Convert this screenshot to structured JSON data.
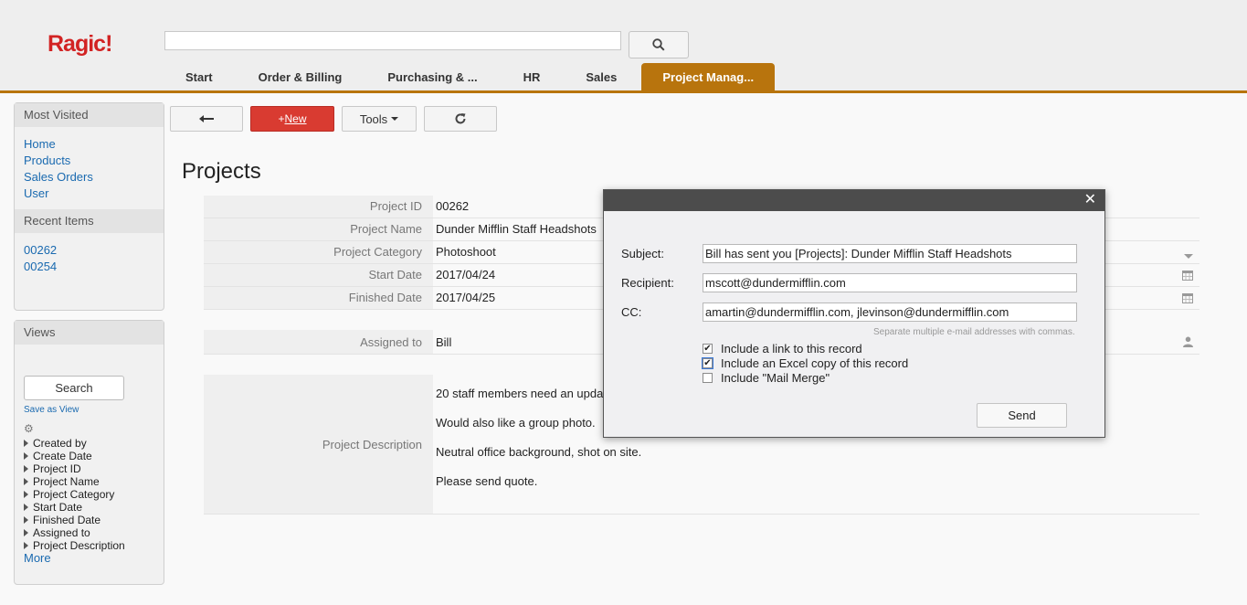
{
  "header": {
    "logo": "Ragic!",
    "search_value": "",
    "tabs": [
      {
        "label": "Start"
      },
      {
        "label": "Order & Billing"
      },
      {
        "label": "Purchasing & ..."
      },
      {
        "label": "HR"
      },
      {
        "label": "Sales"
      },
      {
        "label": "Project Manag..."
      }
    ],
    "accent_color": "#b8740d"
  },
  "sidebar": {
    "most_visited": {
      "title": "Most Visited",
      "links": [
        "Home",
        "Products",
        "Sales Orders",
        "User"
      ]
    },
    "recent_items": {
      "title": "Recent Items",
      "links": [
        "00262",
        "00254"
      ]
    },
    "views": {
      "title": "Views",
      "search_label": "Search",
      "save_as_view": "Save as View",
      "fields": [
        "Created by",
        "Create Date",
        "Project ID",
        "Project Name",
        "Project Category",
        "Start Date",
        "Finished Date",
        "Assigned to",
        "Project Description"
      ],
      "more": "More"
    }
  },
  "toolbar": {
    "new_prefix": "+",
    "new_label": "New",
    "tools_label": "Tools"
  },
  "record": {
    "title": "Projects",
    "fields": {
      "project_id": {
        "label": "Project ID",
        "value": "00262"
      },
      "project_name": {
        "label": "Project Name",
        "value": "Dunder Mifflin Staff Headshots"
      },
      "project_category": {
        "label": "Project Category",
        "value": "Photoshoot"
      },
      "start_date": {
        "label": "Start Date",
        "value": "2017/04/24"
      },
      "finished_date": {
        "label": "Finished Date",
        "value": "2017/04/25"
      },
      "assigned_to": {
        "label": "Assigned to",
        "value": "Bill"
      },
      "project_description": {
        "label": "Project Description",
        "lines": [
          "20 staff members need an upda",
          "Would also like a group photo.",
          "Neutral office background, shot on site.",
          "Please send quote."
        ]
      }
    }
  },
  "email_dialog": {
    "subject_label": "Subject:",
    "subject_value": "Bill has sent you [Projects]: Dunder Mifflin Staff Headshots",
    "recipient_label": "Recipient:",
    "recipient_value": "mscott@dundermifflin.com",
    "cc_label": "CC:",
    "cc_value": "amartin@dundermifflin.com, jlevinson@dundermifflin.com",
    "cc_hint": "Separate multiple e-mail addresses with commas.",
    "options": [
      {
        "label": "Include a link to this record",
        "checked": true
      },
      {
        "label": "Include an Excel copy of this record",
        "checked": true
      },
      {
        "label": "Include \"Mail Merge\"",
        "checked": false
      }
    ],
    "send_label": "Send"
  }
}
